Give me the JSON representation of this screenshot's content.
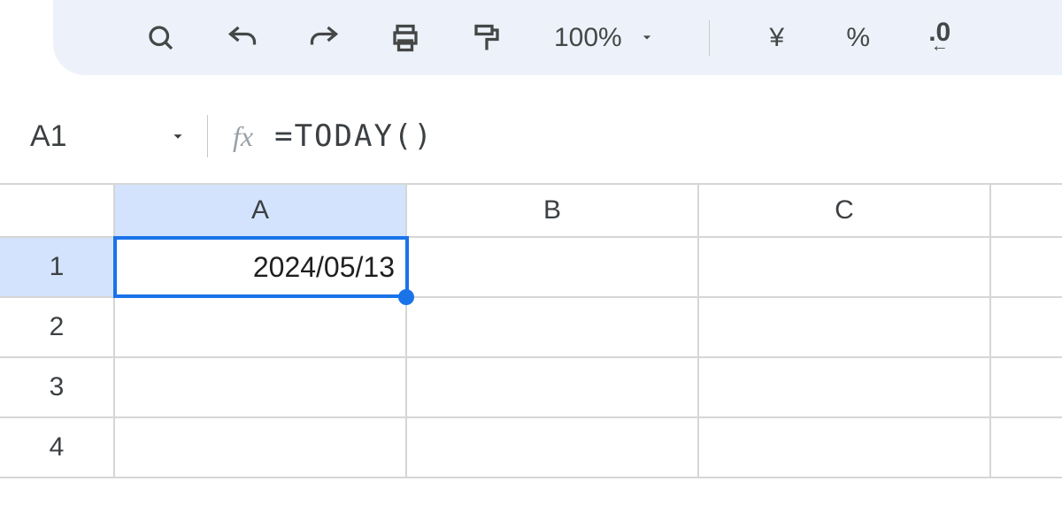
{
  "toolbar": {
    "zoom_label": "100%",
    "currency_label": "¥",
    "percent_label": "%",
    "decimal_label": ".0"
  },
  "namebox": {
    "value": "A1"
  },
  "formula_bar": {
    "fx_label": "fx",
    "formula": "=TODAY()"
  },
  "columns": [
    "A",
    "B",
    "C"
  ],
  "rows": [
    "1",
    "2",
    "3",
    "4"
  ],
  "selected_cell": "A1",
  "cells": {
    "A1": "2024/05/13"
  }
}
